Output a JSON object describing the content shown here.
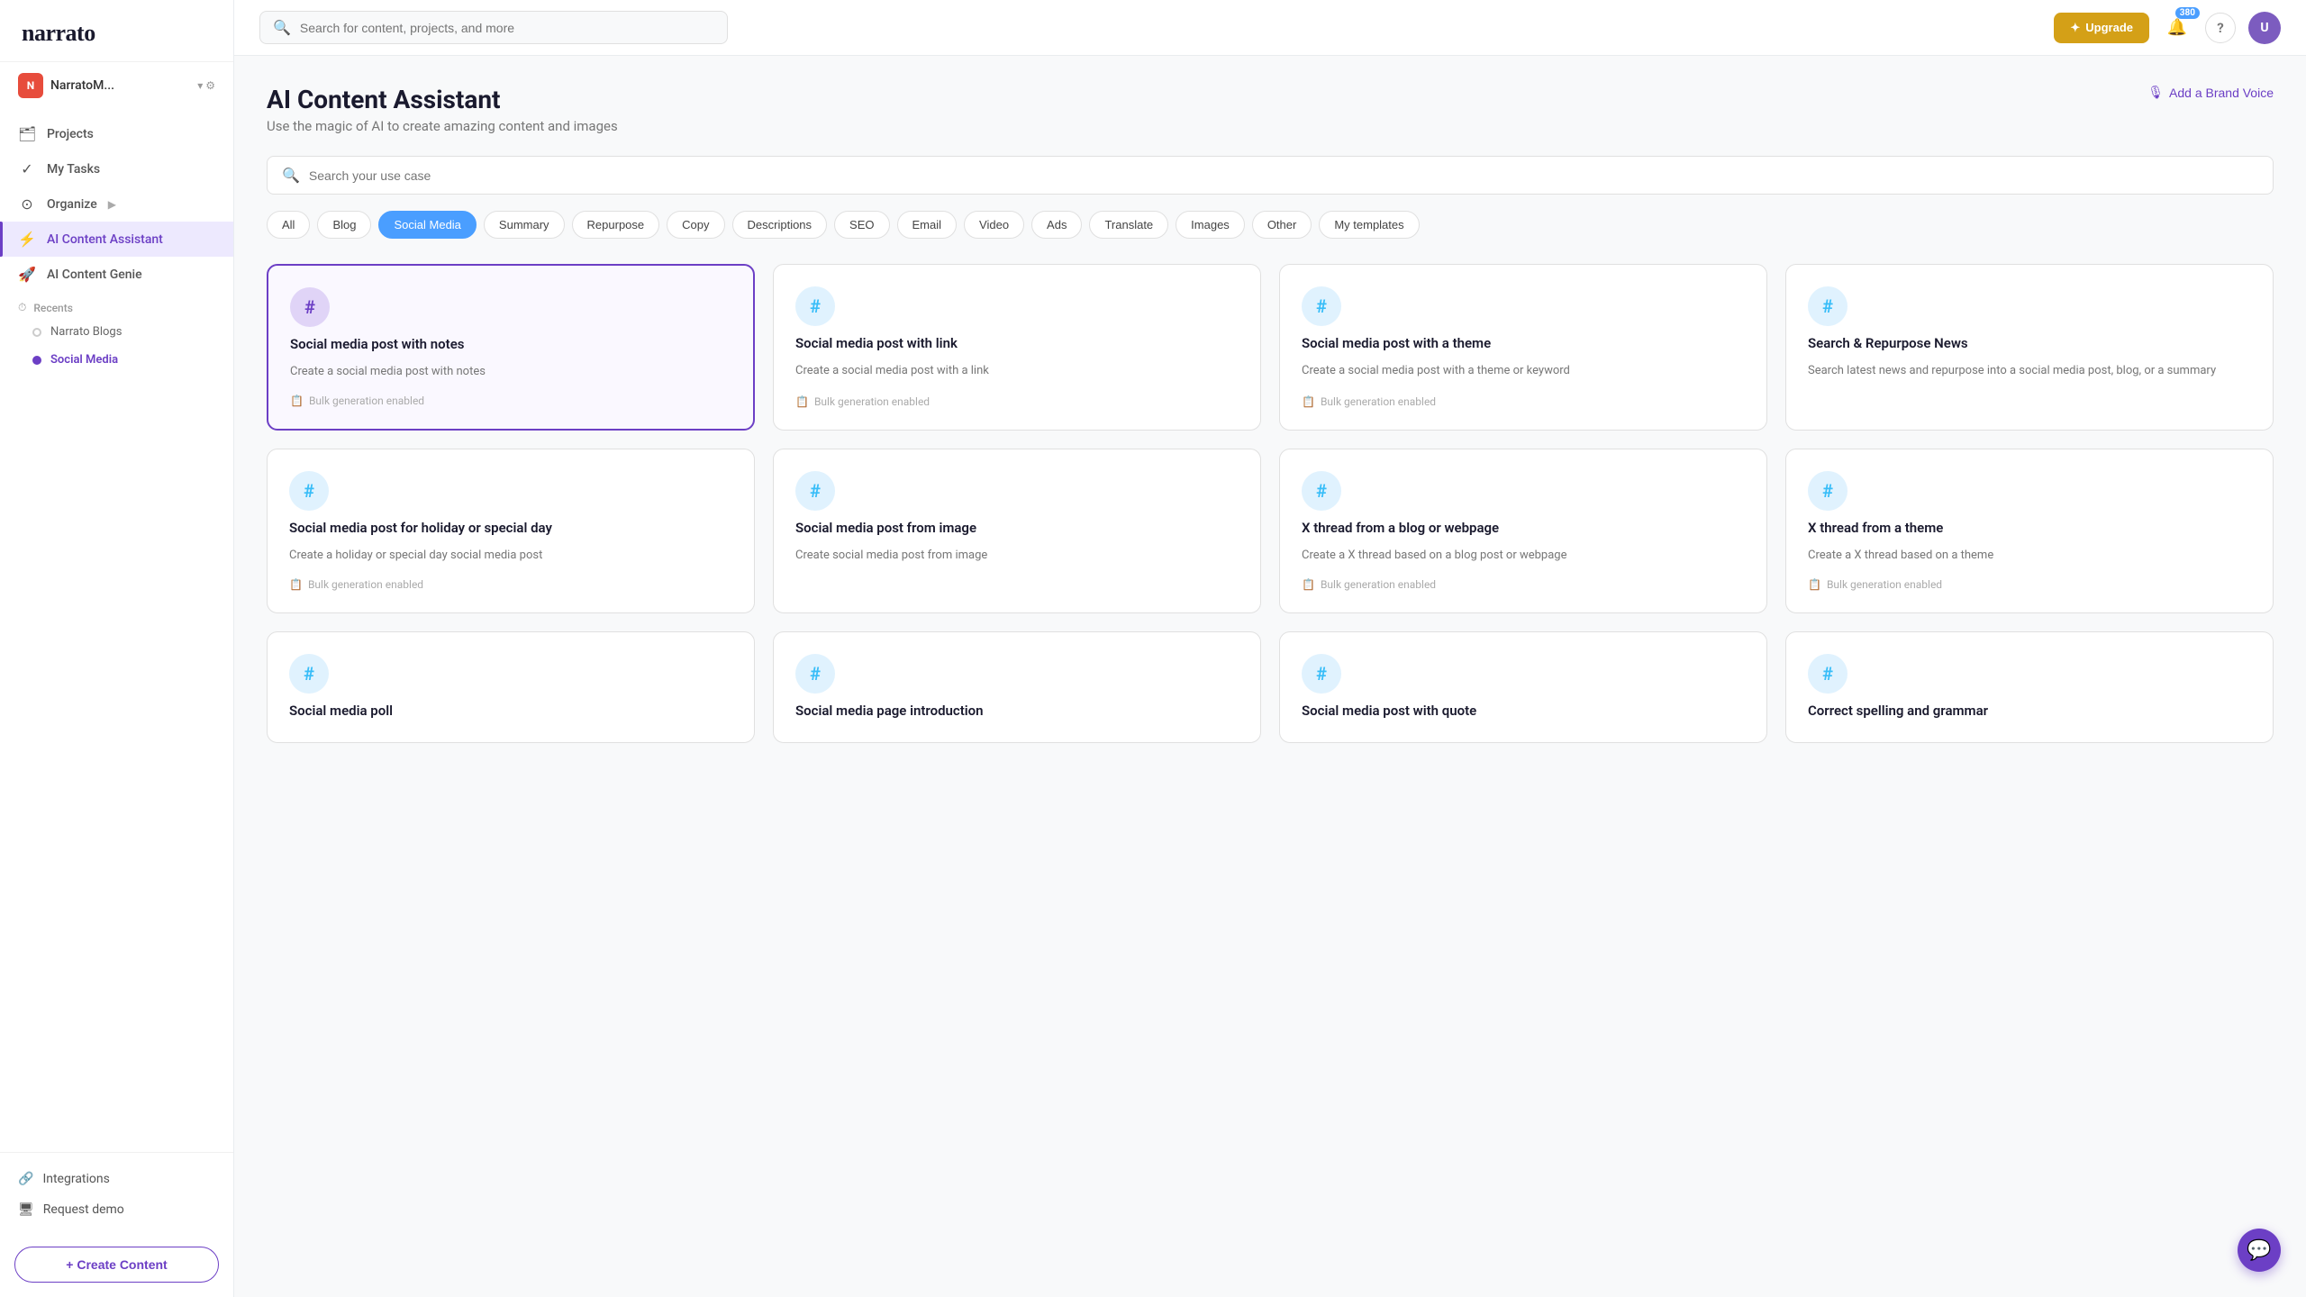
{
  "app": {
    "logo": "narrato",
    "workspace": {
      "avatar_letter": "N",
      "name": "NarratoM...",
      "avatar_bg": "#e74c3c"
    }
  },
  "sidebar": {
    "nav_items": [
      {
        "id": "projects",
        "icon": "🗂",
        "label": "Projects"
      },
      {
        "id": "my-tasks",
        "icon": "✓",
        "label": "My Tasks"
      },
      {
        "id": "organize",
        "icon": "⊙",
        "label": "Organize",
        "has_arrow": true
      },
      {
        "id": "ai-content-assistant",
        "icon": "⚡",
        "label": "AI Content Assistant",
        "active": true
      },
      {
        "id": "ai-content-genie",
        "icon": "🚀",
        "label": "AI Content Genie"
      }
    ],
    "recents_label": "Recents",
    "recents": [
      {
        "id": "narrato-blogs",
        "label": "Narrato Blogs",
        "active": false
      },
      {
        "id": "social-media",
        "label": "Social Media",
        "active": true
      }
    ],
    "bottom_items": [
      {
        "id": "integrations",
        "icon": "🔗",
        "label": "Integrations"
      },
      {
        "id": "request-demo",
        "icon": "🖥",
        "label": "Request demo"
      }
    ],
    "create_btn_label": "+ Create Content"
  },
  "topbar": {
    "search_placeholder": "Search for content, projects, and more",
    "upgrade_btn": "Upgrade",
    "notification_count": "380",
    "upgrade_icon": "✦"
  },
  "page": {
    "title": "AI Content Assistant",
    "subtitle": "Use the magic of AI to create amazing content and images",
    "brand_voice_btn": "Add a Brand Voice",
    "brand_voice_icon": "🎙"
  },
  "use_case_search": {
    "placeholder": "Search your use case"
  },
  "filters": [
    {
      "id": "all",
      "label": "All",
      "active": false
    },
    {
      "id": "blog",
      "label": "Blog",
      "active": false
    },
    {
      "id": "social-media",
      "label": "Social Media",
      "active": true
    },
    {
      "id": "summary",
      "label": "Summary",
      "active": false
    },
    {
      "id": "repurpose",
      "label": "Repurpose",
      "active": false
    },
    {
      "id": "copy",
      "label": "Copy",
      "active": false
    },
    {
      "id": "descriptions",
      "label": "Descriptions",
      "active": false
    },
    {
      "id": "seo",
      "label": "SEO",
      "active": false
    },
    {
      "id": "email",
      "label": "Email",
      "active": false
    },
    {
      "id": "video",
      "label": "Video",
      "active": false
    },
    {
      "id": "ads",
      "label": "Ads",
      "active": false
    },
    {
      "id": "translate",
      "label": "Translate",
      "active": false
    },
    {
      "id": "images",
      "label": "Images",
      "active": false
    },
    {
      "id": "other",
      "label": "Other",
      "active": false
    },
    {
      "id": "my-templates",
      "label": "My templates",
      "active": false
    }
  ],
  "cards": [
    {
      "id": "social-notes",
      "title": "Social media post with notes",
      "desc": "Create a social media post with notes",
      "bulk": "Bulk generation enabled",
      "selected": true,
      "icon": "#"
    },
    {
      "id": "social-link",
      "title": "Social media post with link",
      "desc": "Create a social media post with a link",
      "bulk": "Bulk generation enabled",
      "selected": false,
      "icon": "#"
    },
    {
      "id": "social-theme",
      "title": "Social media post with a theme",
      "desc": "Create a social media post with a theme or keyword",
      "bulk": "Bulk generation enabled",
      "selected": false,
      "icon": "#"
    },
    {
      "id": "search-repurpose-news",
      "title": "Search & Repurpose News",
      "desc": "Search latest news and repurpose into a social media post, blog, or a summary",
      "bulk": null,
      "selected": false,
      "icon": "#"
    },
    {
      "id": "social-holiday",
      "title": "Social media post for holiday or special day",
      "desc": "Create a holiday or special day social media post",
      "bulk": "Bulk generation enabled",
      "selected": false,
      "icon": "#"
    },
    {
      "id": "social-image",
      "title": "Social media post from image",
      "desc": "Create social media post from image",
      "bulk": null,
      "selected": false,
      "icon": "#"
    },
    {
      "id": "x-thread-blog",
      "title": "X thread from a blog or webpage",
      "desc": "Create a X thread based on a blog post or webpage",
      "bulk": "Bulk generation enabled",
      "selected": false,
      "icon": "#"
    },
    {
      "id": "x-thread-theme",
      "title": "X thread from a theme",
      "desc": "Create a X thread based on a theme",
      "bulk": "Bulk generation enabled",
      "selected": false,
      "icon": "#"
    },
    {
      "id": "social-poll",
      "title": "Social media poll",
      "desc": "",
      "bulk": null,
      "selected": false,
      "icon": "#"
    },
    {
      "id": "social-page-intro",
      "title": "Social media page introduction",
      "desc": "",
      "bulk": null,
      "selected": false,
      "icon": "#"
    },
    {
      "id": "social-quote",
      "title": "Social media post with quote",
      "desc": "",
      "bulk": null,
      "selected": false,
      "icon": "#"
    },
    {
      "id": "correct-spelling",
      "title": "Correct spelling and grammar",
      "desc": "",
      "bulk": null,
      "selected": false,
      "icon": "#"
    }
  ],
  "icons": {
    "search": "🔍",
    "bell": "🔔",
    "question": "?",
    "bulk_icon": "📋",
    "mic": "🎙"
  }
}
